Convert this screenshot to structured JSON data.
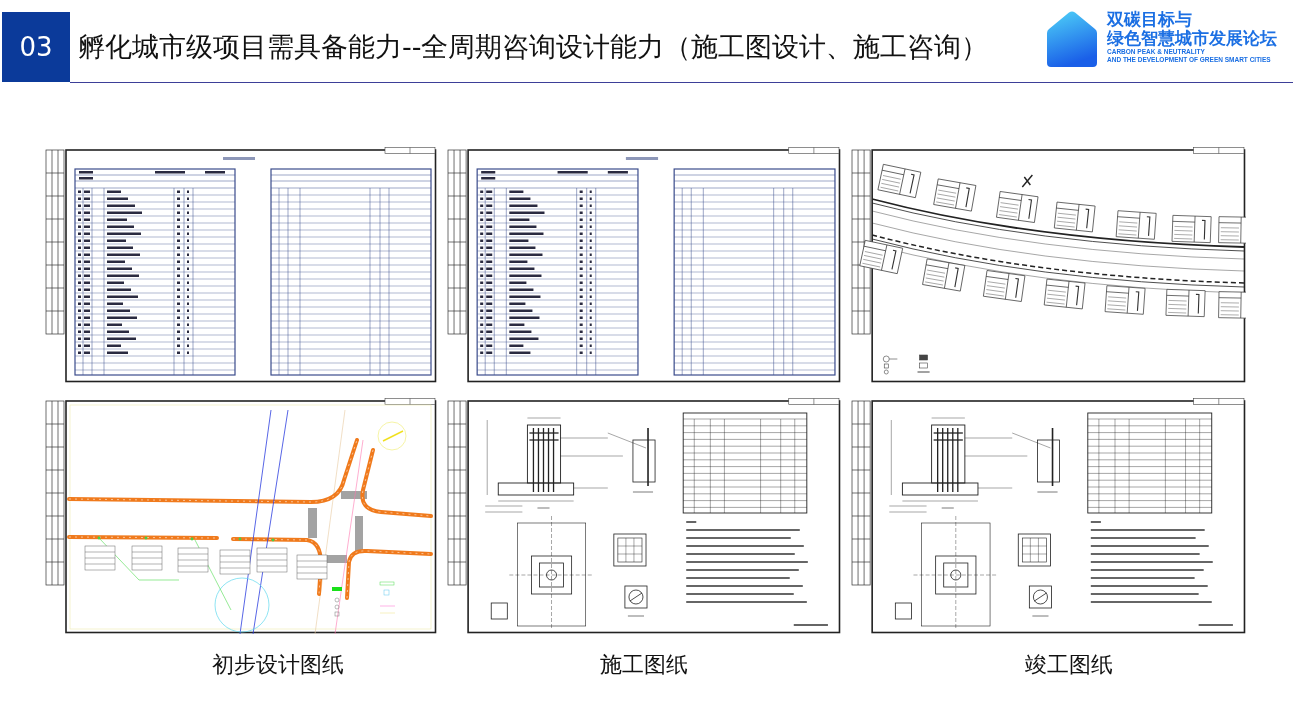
{
  "section_number": "03",
  "title": "孵化城市级项目需具备能力--全周期咨询设计能力（施工图设计、施工咨询）",
  "logo": {
    "cn_lines": [
      "双碳目标与",
      "绿色智慧城市发展论坛"
    ],
    "en_lines": [
      "CARBON PEAK & NEUTRALITY",
      "AND THE DEVELOPMENT OF GREEN SMART CITIES"
    ]
  },
  "columns": [
    {
      "caption": "初步设计图纸",
      "sheets": [
        {
          "kind": "catalog"
        },
        {
          "kind": "road_plan"
        }
      ]
    },
    {
      "caption": "施工图纸",
      "sheets": [
        {
          "kind": "catalog"
        },
        {
          "kind": "foundation"
        }
      ]
    },
    {
      "caption": "竣工图纸",
      "sheets": [
        {
          "kind": "curved_road"
        },
        {
          "kind": "foundation"
        }
      ]
    }
  ]
}
